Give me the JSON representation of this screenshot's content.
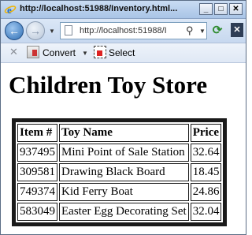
{
  "window": {
    "title": "http://localhost:51988/Inventory.html...",
    "minimize_label": "_",
    "maximize_label": "□",
    "close_label": "✕"
  },
  "address_bar": {
    "url": "http://localhost:51988/I",
    "back_icon": "back-arrow-icon",
    "forward_icon": "forward-arrow-icon",
    "refresh_icon": "refresh-icon"
  },
  "toolbar": {
    "convert_label": "Convert",
    "select_label": "Select"
  },
  "page": {
    "title": "Children Toy Store",
    "table": {
      "headers": [
        "Item #",
        "Toy Name",
        "Price"
      ],
      "rows": [
        [
          "937495",
          "Mini Point of Sale Station",
          "32.64"
        ],
        [
          "309581",
          "Drawing Black Board",
          "18.45"
        ],
        [
          "749374",
          "Kid Ferry Boat",
          "24.86"
        ],
        [
          "583049",
          "Easter Egg Decorating Set",
          "32.04"
        ]
      ]
    }
  },
  "colors": {
    "titlebar": "#b9d1ee",
    "table_border": "#1a1a1a"
  }
}
